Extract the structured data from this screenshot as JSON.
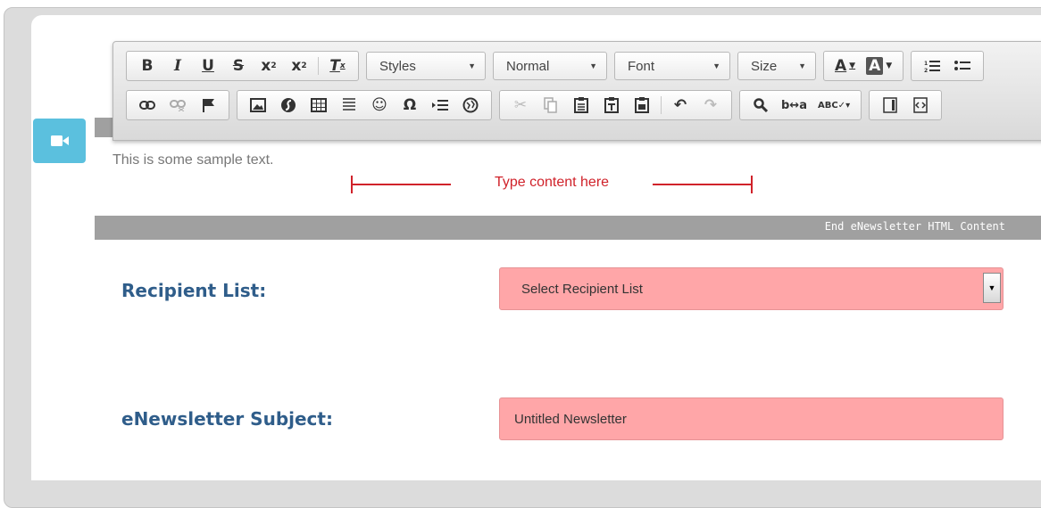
{
  "toolbar": {
    "row1": {
      "basic_styles": [
        {
          "icon": "bold-icon",
          "glyph": "B"
        },
        {
          "icon": "italic-icon",
          "glyph": "I"
        },
        {
          "icon": "underline-icon",
          "glyph": "U"
        },
        {
          "icon": "strikethrough-icon",
          "glyph": "S"
        },
        {
          "icon": "subscript-icon",
          "glyph": "x₂"
        },
        {
          "icon": "superscript-icon",
          "glyph": "x²"
        },
        {
          "icon": "remove-format-icon",
          "glyph": "Tx"
        }
      ],
      "styles_combo": "Styles",
      "format_combo": "Normal",
      "font_combo": "Font",
      "size_combo": "Size",
      "text_color_icon": "text-color-icon",
      "bg_color_icon": "background-color-icon",
      "list_icons": [
        "numbered-list-icon",
        "bulleted-list-icon"
      ]
    },
    "row2": {
      "link_icons": [
        "link-icon",
        "unlink-icon",
        "anchor-flag-icon"
      ],
      "insert_icons": [
        "image-icon",
        "flash-icon",
        "table-icon",
        "horizontal-line-icon",
        "smiley-icon",
        "special-char-icon",
        "page-break-icon",
        "iframe-icon"
      ],
      "clipboard_icons": [
        "cut-icon",
        "copy-icon",
        "paste-icon",
        "paste-text-icon",
        "paste-word-icon"
      ],
      "undo_icons": [
        "undo-icon",
        "redo-icon"
      ],
      "find_icons": [
        "find-icon",
        "replace-icon",
        "spellcheck-icon"
      ],
      "misc_icons": [
        "templates-icon",
        "source-icon"
      ]
    }
  },
  "editor": {
    "sample_text": "This is some sample text.",
    "annotation": "Type content here",
    "end_marker": "End eNewsletter HTML Content"
  },
  "form": {
    "recipient_label": "Recipient List:",
    "recipient_selected": "Select Recipient List",
    "subject_label": "eNewsletter Subject:",
    "subject_value": "Untitled Newsletter"
  },
  "colors": {
    "accent_button": "#5bc0de",
    "label_blue": "#2f5d8a",
    "required_field_bg": "#ffa6a8",
    "annotation_red": "#d0222a"
  }
}
